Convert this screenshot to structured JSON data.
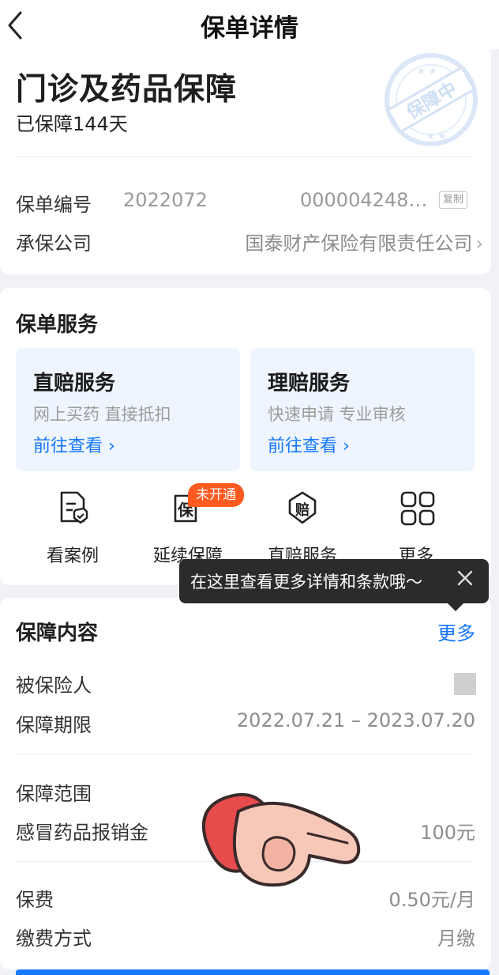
{
  "header": {
    "title": "保单详情"
  },
  "policy": {
    "product_name": "门诊及药品保障",
    "days_protected": "已保障144天",
    "stamp_text": "保障中",
    "number_label": "保单编号",
    "number_prefix": "2022072",
    "number_suffix": "000004248…",
    "copy_label": "复制",
    "insurer_label": "承保公司",
    "insurer_value": "国泰财产保险有限责任公司"
  },
  "services": {
    "title": "保单服务",
    "boxes": [
      {
        "title": "直赔服务",
        "subtitle": "网上买药 直接抵扣",
        "link": "前往查看 ›"
      },
      {
        "title": "理赔服务",
        "subtitle": "快速申请 专业审核",
        "link": "前往查看 ›"
      }
    ],
    "icons": [
      {
        "label": "看案例",
        "icon": "document-shield-icon"
      },
      {
        "label": "延续保障",
        "icon": "renew-policy-icon"
      },
      {
        "label": "直赔服务",
        "icon": "claim-shield-icon"
      },
      {
        "label": "更多",
        "icon": "grid-icon"
      }
    ],
    "badge": "未开通"
  },
  "tooltip": {
    "text": "在这里查看更多详情和条款哦～"
  },
  "coverage": {
    "title": "保障内容",
    "more": "更多",
    "insured_label": "被保险人",
    "period_label": "保障期限",
    "period_value": "2022.07.21 – 2023.07.20",
    "scope_label": "保障范围",
    "item_label": "感冒药品报销金",
    "item_value": "100元",
    "premium_label": "保费",
    "premium_value": "0.50元/月",
    "payment_label": "缴费方式",
    "payment_value": "月缴"
  },
  "colors": {
    "accent": "#1677ff",
    "badge": "#ff5a1f",
    "tooltip_bg": "#2b2b2b"
  }
}
